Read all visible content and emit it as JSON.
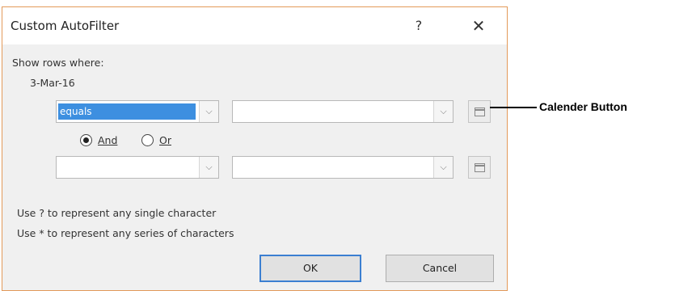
{
  "dialog": {
    "title": "Custom AutoFilter",
    "help_label": "?",
    "close_label": "✕",
    "show_rows_label": "Show rows where:",
    "column_name": "3-Mar-16",
    "row1": {
      "operator": "equals",
      "value": ""
    },
    "logic": {
      "and_label": "And",
      "or_label": "Or",
      "selected": "And"
    },
    "row2": {
      "operator": "",
      "value": ""
    },
    "hint1": "Use ? to represent any single character",
    "hint2": "Use * to represent any series of characters",
    "ok_label": "OK",
    "cancel_label": "Cancel"
  },
  "icons": {
    "dropdown": "chevron-down-icon",
    "calendar": "calendar-icon"
  },
  "annotation": {
    "text": "Calender Button"
  },
  "colors": {
    "selection": "#3d8fe0",
    "default_button_border": "#3b7fd1",
    "dialog_border": "#e39a5a"
  }
}
